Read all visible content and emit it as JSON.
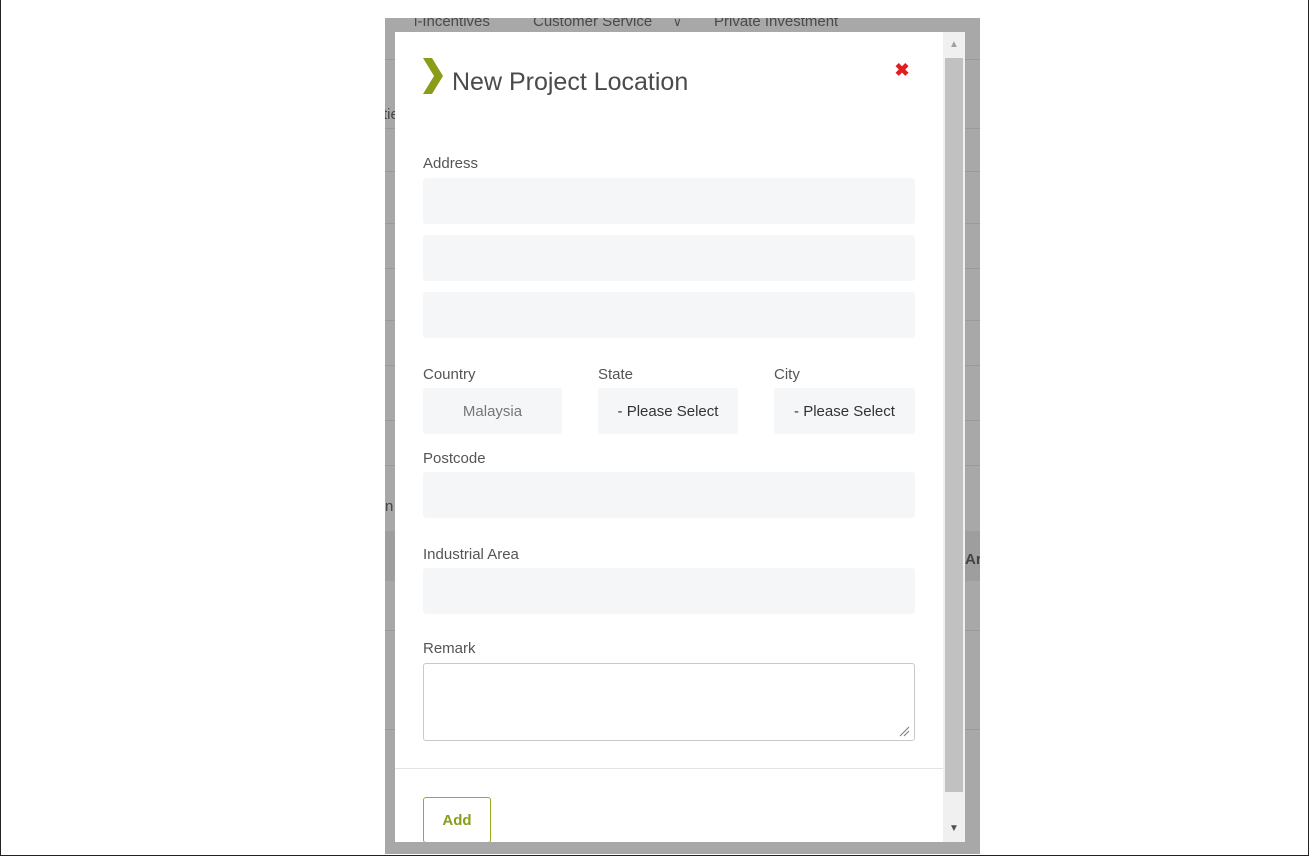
{
  "background": {
    "nav": {
      "item_1": "i-Incentives",
      "item_2": "Customer Service",
      "item_2_chevron": "chevron-down-icon",
      "item_3": "Private Investment"
    },
    "fragments": {
      "left_1": "tie",
      "left_2": "n",
      "right_1": "Ar"
    }
  },
  "modal": {
    "title": "New Project Location",
    "title_icon": "chevron-right-icon",
    "close_icon": "close-icon",
    "address_label": "Address",
    "address_line_1": "",
    "address_line_2": "",
    "address_line_3": "",
    "country_label": "Country",
    "country_value": "Malaysia",
    "state_label": "State",
    "state_value": "- Please Select",
    "city_label": "City",
    "city_value": "- Please Select",
    "postcode_label": "Postcode",
    "postcode_value": "",
    "industrial_area_label": "Industrial Area",
    "industrial_area_value": "",
    "remark_label": "Remark",
    "remark_value": "",
    "add_button": "Add"
  },
  "colors": {
    "accent": "#8a9c1a",
    "close": "#e02020",
    "input_bg": "#f5f6f7",
    "backdrop": "#a8a8a8"
  }
}
